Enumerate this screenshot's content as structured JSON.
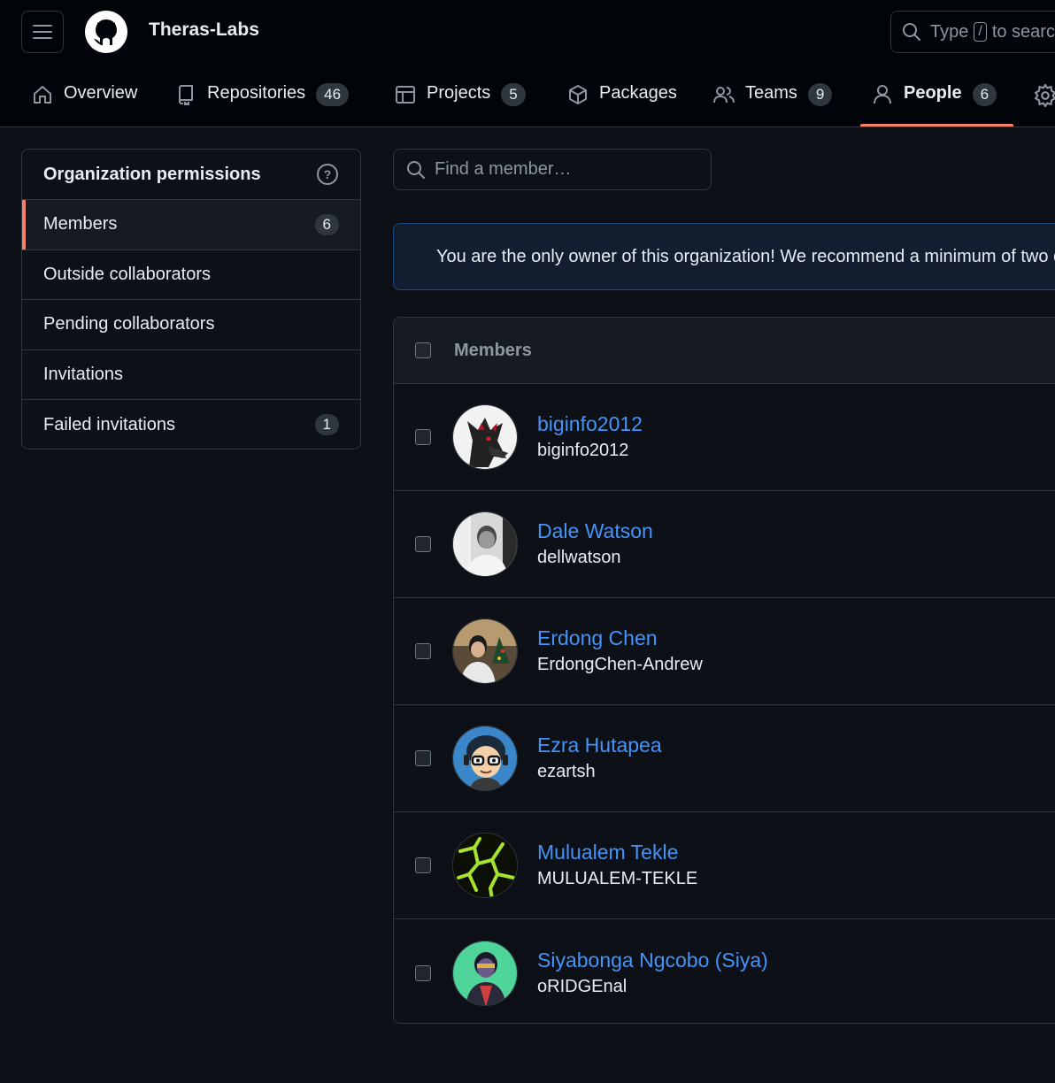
{
  "header": {
    "org_name": "Theras-Labs",
    "search_prefix": "Type",
    "search_key": "/",
    "search_suffix": "to search"
  },
  "tabs": [
    {
      "label": "Overview",
      "icon": "home-icon"
    },
    {
      "label": "Repositories",
      "count": "46",
      "icon": "repo-icon"
    },
    {
      "label": "Projects",
      "count": "5",
      "icon": "table-icon"
    },
    {
      "label": "Packages",
      "count": "",
      "icon": "package-icon"
    },
    {
      "label": "Teams",
      "count": "9",
      "icon": "people-icon"
    },
    {
      "label": "People",
      "count": "6",
      "icon": "person-icon",
      "active": true
    },
    {
      "label": "",
      "icon": "gear-icon"
    }
  ],
  "sidebar": {
    "title": "Organization permissions",
    "items": [
      {
        "label": "Members",
        "count": "6",
        "selected": true
      },
      {
        "label": "Outside collaborators"
      },
      {
        "label": "Pending collaborators"
      },
      {
        "label": "Invitations"
      },
      {
        "label": "Failed invitations",
        "count": "1"
      }
    ]
  },
  "search": {
    "placeholder": "Find a member…"
  },
  "banner": {
    "text": "You are the only owner of this organization! We recommend a minimum of two owners."
  },
  "members": {
    "header": "Members",
    "rows": [
      {
        "name": "biginfo2012",
        "login": "biginfo2012"
      },
      {
        "name": "Dale Watson",
        "login": "dellwatson"
      },
      {
        "name": "Erdong Chen",
        "login": "ErdongChen-Andrew"
      },
      {
        "name": "Ezra Hutapea",
        "login": "ezartsh"
      },
      {
        "name": "Mulualem Tekle",
        "login": "MULUALEM-TEKLE"
      },
      {
        "name": "Siyabonga Ngcobo (Siya)",
        "login": "oRIDGEnal"
      }
    ]
  },
  "colors": {
    "accent_underline": "#f78166",
    "link": "#4493f8",
    "background": "#0d1117",
    "header_background": "#010409"
  }
}
